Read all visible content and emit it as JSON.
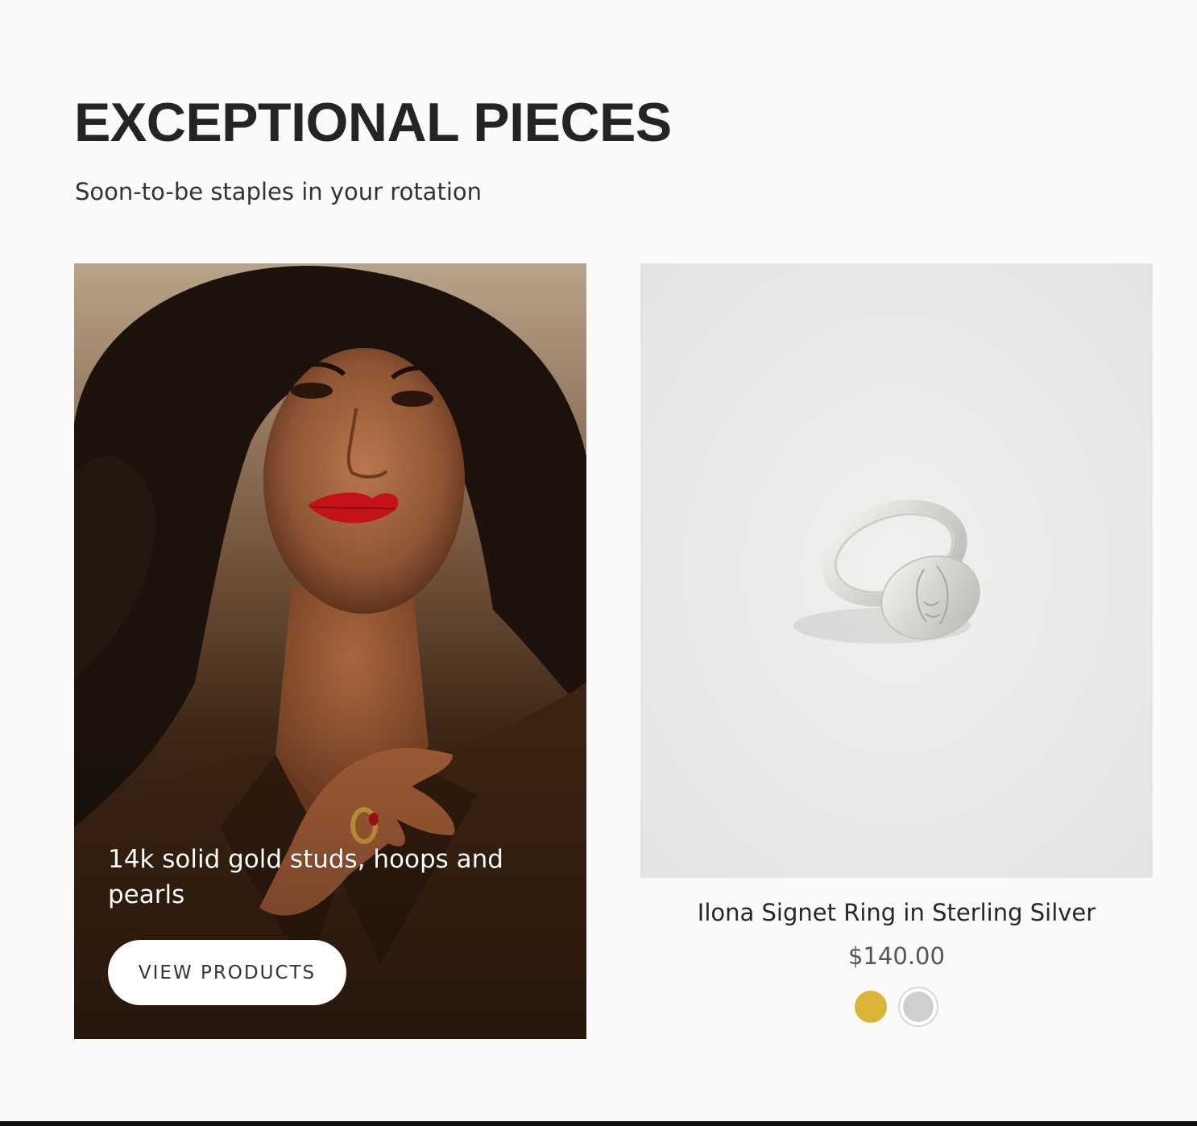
{
  "section": {
    "title": "EXCEPTIONAL PIECES",
    "subtitle": "Soon-to-be staples in your rotation"
  },
  "promo": {
    "text": "14k solid gold studs, hoops and pearls",
    "button_label": "VIEW PRODUCTS",
    "image_alt": "Woman with curly hair and red lipstick wearing gold rings and a brown blazer"
  },
  "product": {
    "title": "Ilona Signet Ring in Sterling Silver",
    "price": "$140.00",
    "image_alt": "Sterling silver signet ring engraved with a face outline",
    "swatches": [
      {
        "name": "Gold",
        "color": "#d9b437"
      },
      {
        "name": "Sterling Silver",
        "color": "#cfcfcf"
      }
    ]
  }
}
